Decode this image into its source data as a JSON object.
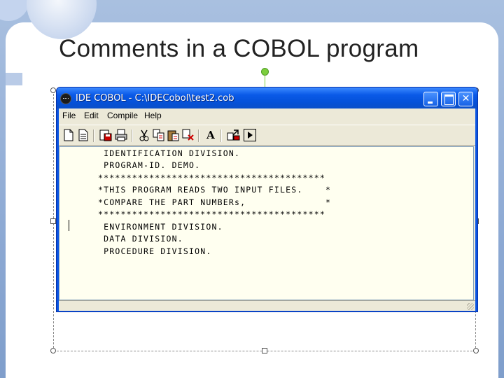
{
  "slide": {
    "title": "Comments in a COBOL program"
  },
  "window": {
    "title": "IDE COBOL - C:\\IDECobol\\test2.cob",
    "icon": "app-icon",
    "controls": {
      "minimize": "minimize-icon",
      "maximize": "maximize-icon",
      "close_glyph": "✕"
    }
  },
  "menu": {
    "items": [
      "File",
      "Edit",
      "Compile",
      "Help"
    ]
  },
  "toolbar": {
    "buttons": [
      "new-file-icon",
      "open-file-icon",
      "save-icon",
      "print-icon",
      "cut-icon",
      "copy-icon",
      "paste-icon",
      "delete-icon",
      "font-icon",
      "compile-icon",
      "run-icon"
    ],
    "font_glyph": "A"
  },
  "editor": {
    "lines": [
      " IDENTIFICATION DIVISION.",
      " PROGRAM-ID. DEMO.",
      "****************************************",
      "*THIS PROGRAM READS TWO INPUT FILES.    *",
      "*COMPARE THE PART NUMBERs,              *",
      "****************************************",
      " ENVIRONMENT DIVISION.",
      " DATA DIVISION.",
      " PROCEDURE DIVISION."
    ]
  },
  "colors": {
    "titlebar": "#0a5ae8",
    "editor_bg": "#fffff0",
    "selection_handle": "#7ccf3c"
  }
}
